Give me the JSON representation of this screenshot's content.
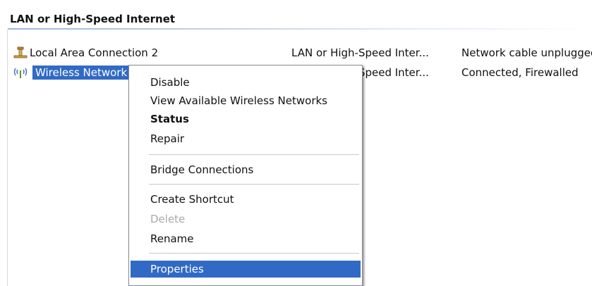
{
  "group": {
    "header": "LAN or High-Speed Internet"
  },
  "connections": [
    {
      "name": "Local Area Connection 2",
      "type": "LAN or High-Speed Inter...",
      "status": "Network cable unplugged",
      "icon": "lan-connection-icon"
    },
    {
      "name": "Wireless Network Connection",
      "type": "LAN or High-Speed Inter...",
      "status": "Connected, Firewalled",
      "icon": "wireless-connection-icon",
      "selected": true
    }
  ],
  "context_menu": {
    "items": [
      {
        "label": "Disable"
      },
      {
        "label": "View Available Wireless Networks"
      },
      {
        "label": "Status",
        "bold": true
      },
      {
        "label": "Repair"
      },
      {
        "label": "Bridge Connections"
      },
      {
        "label": "Create Shortcut"
      },
      {
        "label": "Delete",
        "disabled": true
      },
      {
        "label": "Rename"
      },
      {
        "label": "Properties",
        "highlighted": true
      }
    ]
  },
  "colors": {
    "selection": "#316ac5",
    "disabled_text": "#a8a8a8"
  }
}
